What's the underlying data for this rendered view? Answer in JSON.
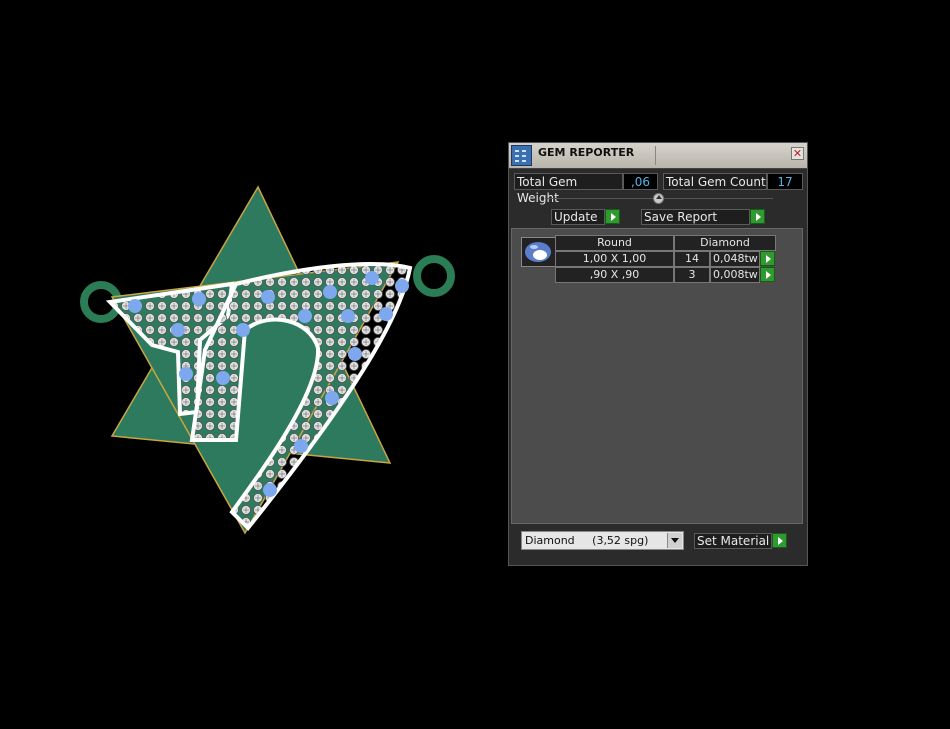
{
  "window": {
    "title": "GEM REPORTER"
  },
  "summary": {
    "total_weight_label": "Total Gem Weight",
    "total_weight_value": ",06",
    "total_count_label": "Total Gem Count",
    "total_count_value": "17"
  },
  "buttons": {
    "update": "Update",
    "save_report": "Save Report",
    "set_material": "Set Material"
  },
  "table": {
    "headers": [
      "Round",
      "Diamond"
    ],
    "rows": [
      {
        "size": "1,00 X 1,00",
        "count": "14",
        "weight": "0,048tw"
      },
      {
        "size": ",90 X ,90",
        "count": "3",
        "weight": "0,008tw"
      }
    ]
  },
  "material": {
    "selected": "Diamond     (3,52 spg)"
  },
  "colors": {
    "accent": "#2f9a2f",
    "value_text": "#57b4e6",
    "panel_bg": "#2b2b2b",
    "list_bg": "#4c4c4c",
    "model_green": "#2e7a5e"
  }
}
